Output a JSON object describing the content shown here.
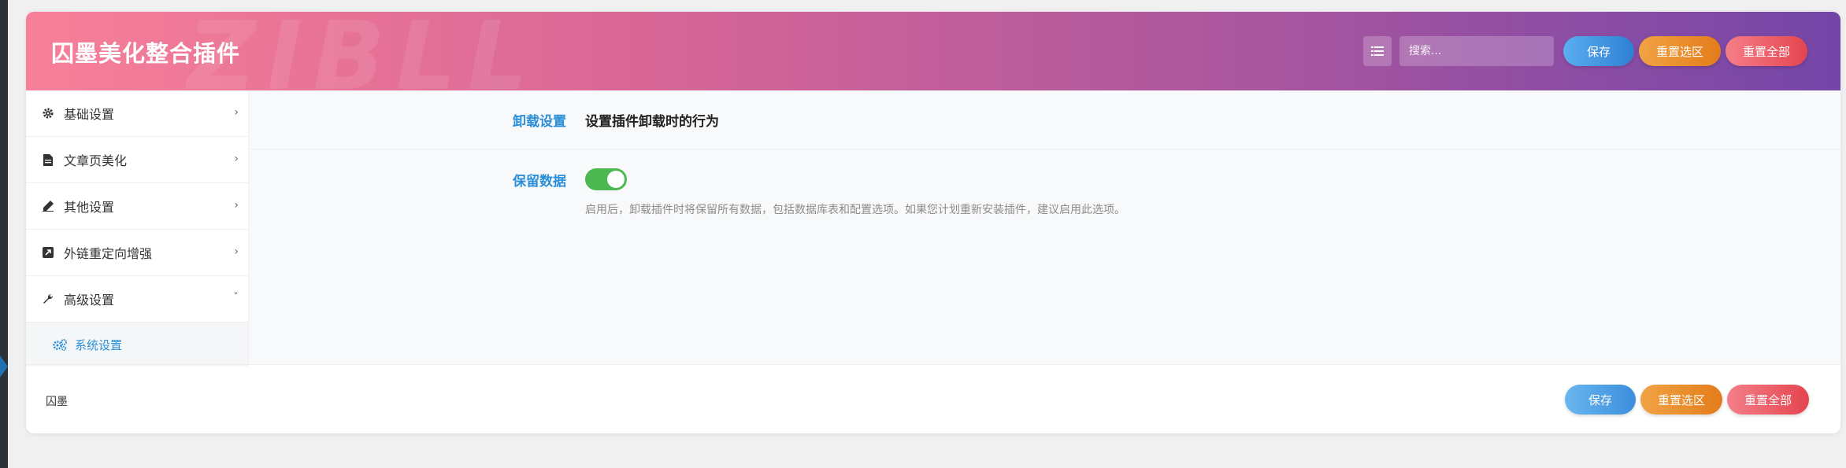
{
  "header": {
    "title": "囚墨美化整合插件",
    "watermark": "ZIBLL",
    "search_placeholder": "搜索...",
    "save_label": "保存",
    "reset_section_label": "重置选区",
    "reset_all_label": "重置全部"
  },
  "sidebar": {
    "items": [
      {
        "label": "基础设置",
        "icon": "gear-icon",
        "expanded": false
      },
      {
        "label": "文章页美化",
        "icon": "file-icon",
        "expanded": false
      },
      {
        "label": "其他设置",
        "icon": "pen-icon",
        "expanded": false
      },
      {
        "label": "外链重定向增强",
        "icon": "external-link-icon",
        "expanded": false
      },
      {
        "label": "高级设置",
        "icon": "wrench-icon",
        "expanded": true
      }
    ],
    "sub_items": [
      {
        "label": "系统设置",
        "icon": "cogs-icon",
        "active": true
      }
    ]
  },
  "content": {
    "section_label": "卸载设置",
    "section_desc": "设置插件卸载时的行为",
    "option_label": "保留数据",
    "option_enabled": true,
    "option_help": "启用后，卸载插件时将保留所有数据，包括数据库表和配置选项。如果您计划重新安装插件，建议启用此选项。"
  },
  "footer": {
    "text": "囚墨",
    "save_label": "保存",
    "reset_section_label": "重置选区",
    "reset_all_label": "重置全部"
  },
  "colors": {
    "accent_blue": "#2a8fd8",
    "toggle_on": "#4cb851",
    "header_start": "#f77f98",
    "header_end": "#7446a8"
  }
}
